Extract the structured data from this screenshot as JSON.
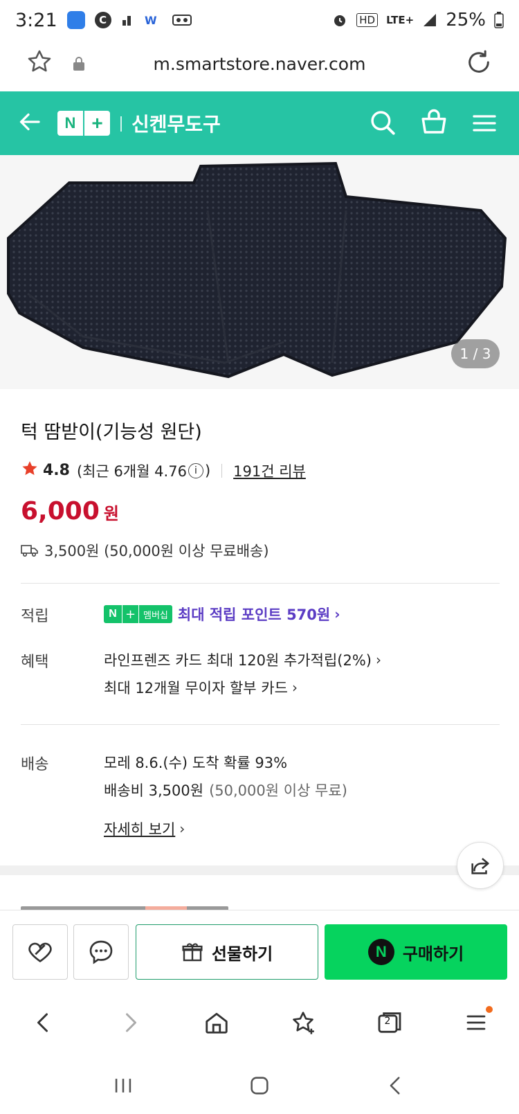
{
  "status_bar": {
    "time": "3:21",
    "battery": "25%",
    "network": "LTE+",
    "hd": "HD"
  },
  "browser": {
    "url": "m.smartstore.naver.com"
  },
  "header": {
    "logo_n": "N",
    "logo_plus": "+",
    "store_name": "신켄무도구"
  },
  "product": {
    "image_page": "1 / 3",
    "title": "턱 땀받이(기능성 원단)",
    "rating": "4.8",
    "rating_detail_prefix": "(최근 6개월 4.76",
    "rating_detail_suffix": ")",
    "review_link": "191건 리뷰",
    "price": "6,000",
    "price_unit": "원",
    "shipping": "3,500원 (50,000원 이상 무료배송)"
  },
  "details": {
    "points_label": "적립",
    "points_badge_text": "멤버십",
    "points_text": "최대 적립 포인트 570원",
    "benefit_label": "혜택",
    "benefit_line1": "라인프렌즈 카드 최대 120원 추가적립(2%)",
    "benefit_line2": "최대 12개월 무이자 할부 카드",
    "delivery_label": "배송",
    "delivery_line1": "모레 8.6.(수) 도착 확률 93%",
    "delivery_fee": "배송비 3,500원",
    "delivery_fee_note": "(50,000원 이상 무료)",
    "detail_link": "자세히 보기"
  },
  "buy_bar": {
    "gift_label": "선물하기",
    "buy_label": "구매하기",
    "npay_letter": "N"
  },
  "browser_nav": {
    "tab_count": "2"
  },
  "colors": {
    "brand_green": "#26c4a4",
    "price_red": "#c8102e",
    "buy_green": "#06d35e",
    "points_purple": "#5b3cc4"
  }
}
